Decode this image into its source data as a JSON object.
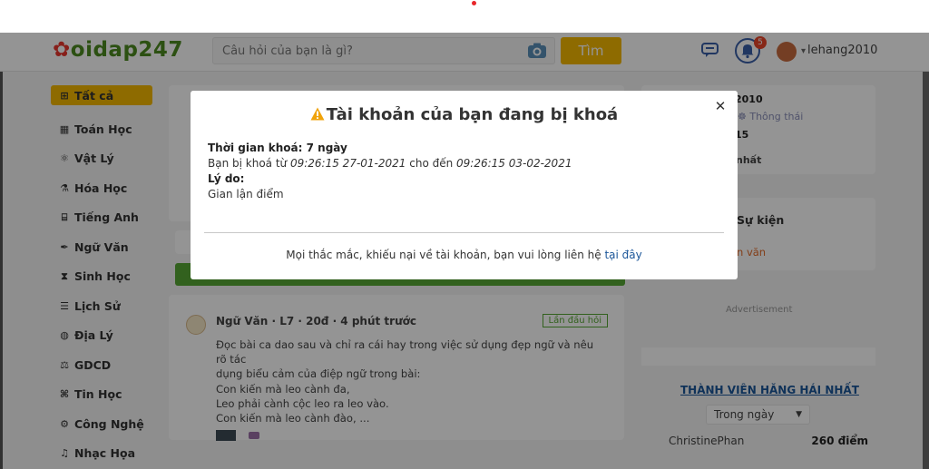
{
  "header": {
    "logo_text": "oidap247",
    "search_placeholder": "Câu hỏi của bạn là gì?",
    "search_button": "Tìm",
    "notification_count": "5",
    "username": "lehang2010"
  },
  "sidebar": {
    "items": [
      {
        "label": "Tất cả",
        "icon": "grid-icon",
        "active": true
      },
      {
        "label": "Toán Học",
        "icon": "calculator-icon"
      },
      {
        "label": "Vật Lý",
        "icon": "atom-icon"
      },
      {
        "label": "Hóa Học",
        "icon": "flask-icon"
      },
      {
        "label": "Tiếng Anh",
        "icon": "language-icon"
      },
      {
        "label": "Ngữ Văn",
        "icon": "quill-icon"
      },
      {
        "label": "Sinh Học",
        "icon": "dna-icon"
      },
      {
        "label": "Lịch Sử",
        "icon": "scroll-icon"
      },
      {
        "label": "Địa Lý",
        "icon": "globe-icon"
      },
      {
        "label": "GDCD",
        "icon": "law-icon"
      },
      {
        "label": "Tin Học",
        "icon": "computer-icon"
      },
      {
        "label": "Công Nghệ",
        "icon": "gear-icon"
      },
      {
        "label": "Nhạc Họa",
        "icon": "music-icon"
      }
    ]
  },
  "question": {
    "meta": "Ngữ Văn · L7 · 20đ · 4 phút trước",
    "tag": "Lần đầu hỏi",
    "lines": [
      "Đọc bài ca dao sau và chỉ ra cái hay trong việc sử dụng đẹp ngữ và nêu rõ tác",
      "dụng biểu cảm của điệp ngữ trong bài:",
      "Con kiến mà leo cành đa,",
      "Leo phải cành cộc leo ra leo vào.",
      "Con kiến mà leo cành đào, ..."
    ]
  },
  "right_panel": {
    "profile_line1": "2010",
    "profile_line2": "Thông thái",
    "profile_line3": "15",
    "profile_line4": "nhất",
    "events_title": "Sự kiện",
    "events_link": "n văn",
    "ad_label": "Advertisement",
    "leaders_title": "THÀNH VIÊN HĂNG HÁI NHẤT",
    "period_select": "Trong ngày",
    "leaders": [
      {
        "name": "ChristinePhan",
        "points": "260 điểm"
      }
    ]
  },
  "modal": {
    "title": "Tài khoản của bạn đang bị khoá",
    "lock_duration_label": "Thời gian khoá: 7 ngày",
    "lock_prefix": "Bạn bị khoá từ ",
    "lock_from": "09:26:15 27-01-2021",
    "lock_middle": " cho đến ",
    "lock_to": "09:26:15 03-02-2021",
    "reason_label": "Lý do:",
    "reason": "Gian lận điểm",
    "footer_text": "Mọi thắc mắc, khiếu nại về tài khoản, bạn vui lòng liên hệ ",
    "footer_link": "tại đây"
  },
  "colors": {
    "accent_yellow": "#f4b800",
    "brand_green": "#57a834",
    "link_blue": "#1b5699",
    "warning_orange": "#f0a30a"
  }
}
